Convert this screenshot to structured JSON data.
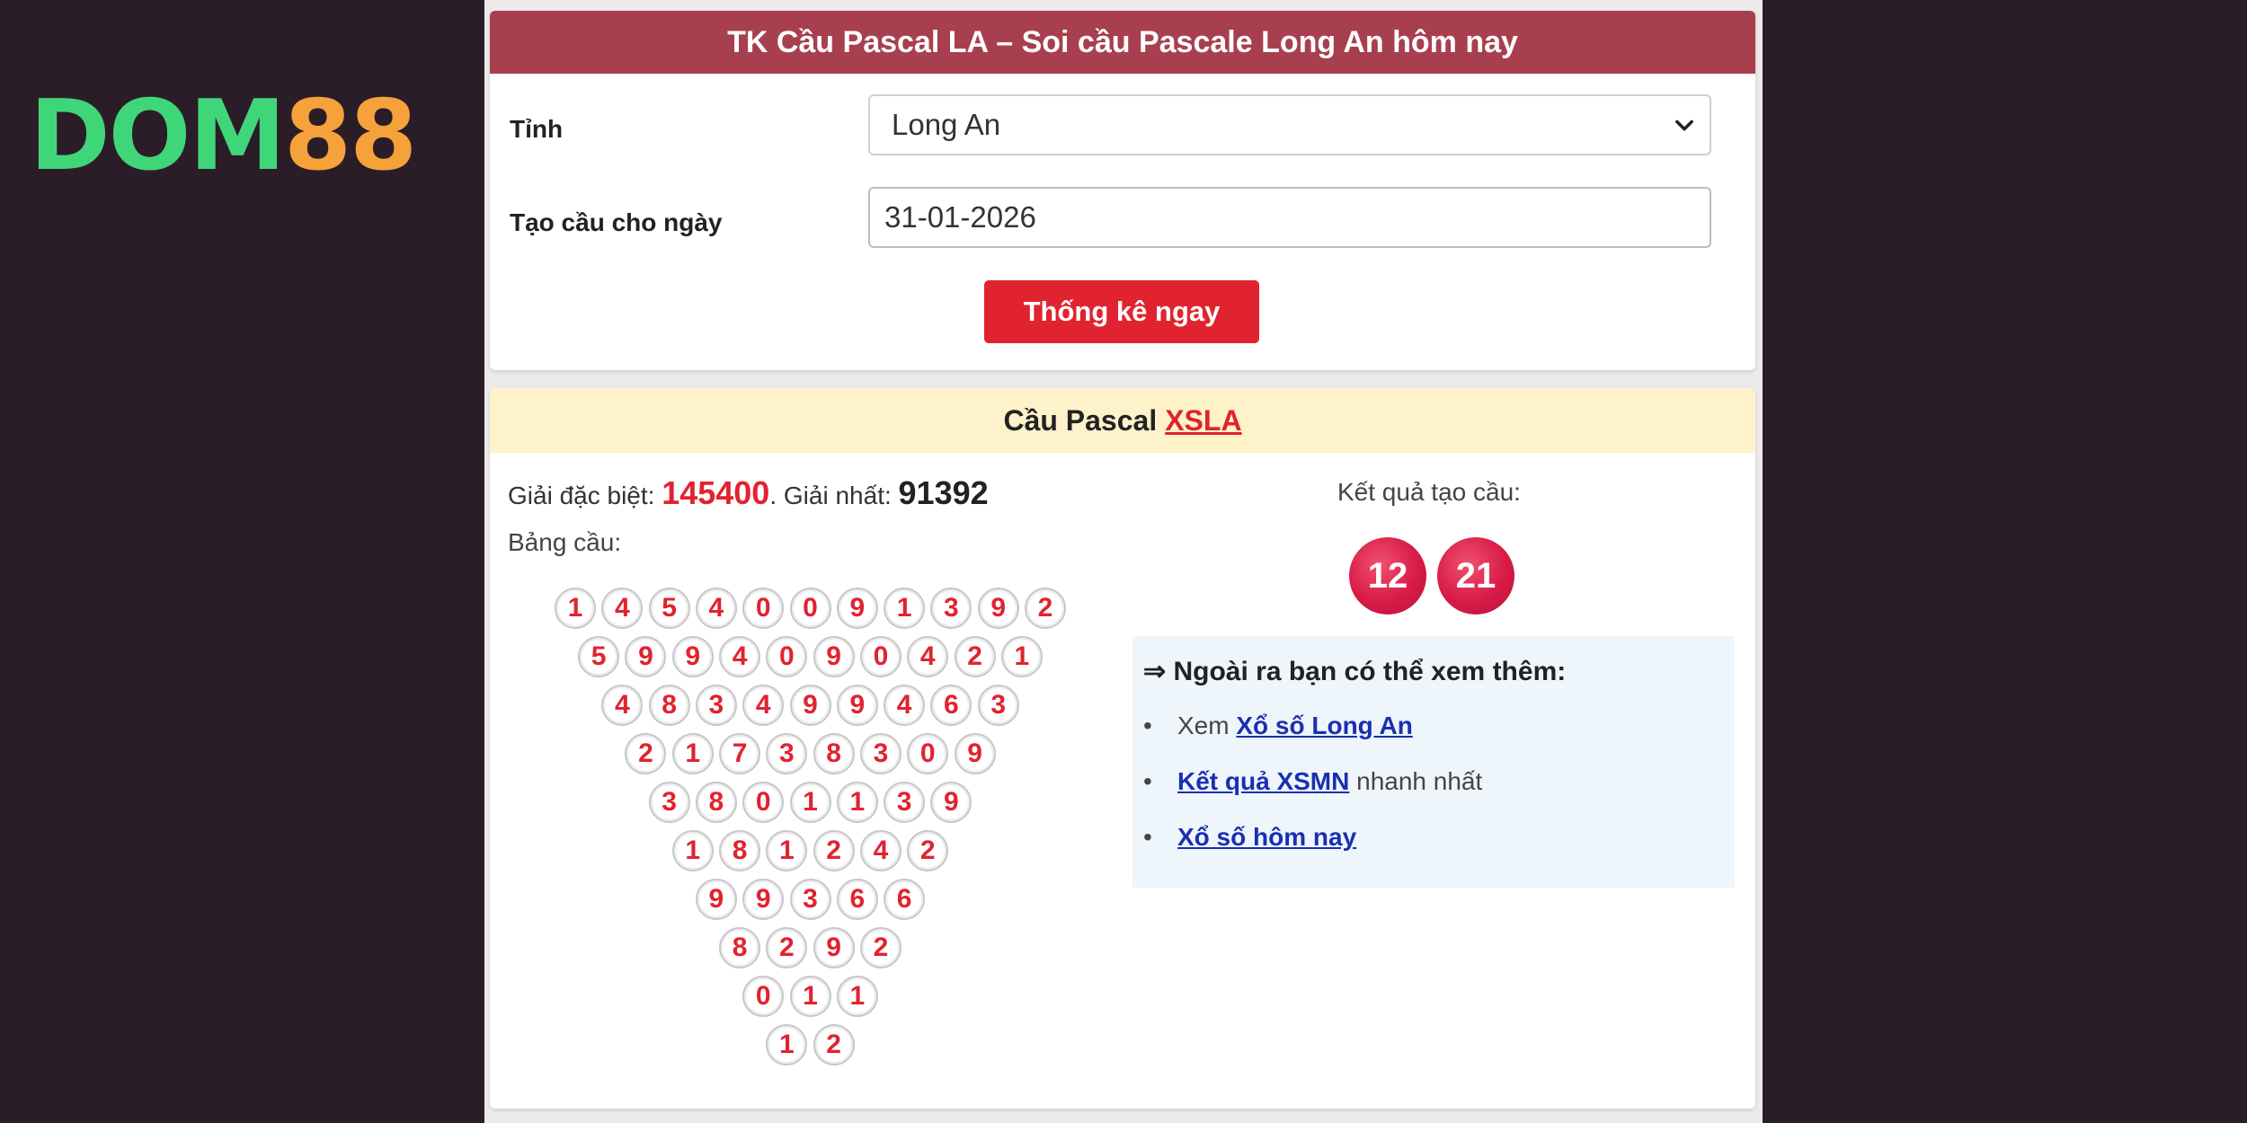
{
  "logo": {
    "part1": "DOM",
    "part2": "88"
  },
  "form": {
    "header": "TK Cầu Pascal LA – Soi cầu Pascale Long An hôm nay",
    "province_label": "Tỉnh",
    "province_value": "Long An",
    "date_label": "Tạo cầu cho ngày",
    "date_value": "31-01-2026",
    "submit_label": "Thống kê ngay"
  },
  "pascal": {
    "header_prefix": "Cầu Pascal",
    "header_link": "XSLA",
    "special_label": "Giải đặc biệt:",
    "special_value": "145400",
    "first_sep": ". Giải nhất:",
    "first_value": "91392",
    "table_label": "Bảng cầu:",
    "rows": [
      [
        "1",
        "4",
        "5",
        "4",
        "0",
        "0",
        "9",
        "1",
        "3",
        "9",
        "2"
      ],
      [
        "5",
        "9",
        "9",
        "4",
        "0",
        "9",
        "0",
        "4",
        "2",
        "1"
      ],
      [
        "4",
        "8",
        "3",
        "4",
        "9",
        "9",
        "4",
        "6",
        "3"
      ],
      [
        "2",
        "1",
        "7",
        "3",
        "8",
        "3",
        "0",
        "9"
      ],
      [
        "3",
        "8",
        "0",
        "1",
        "1",
        "3",
        "9"
      ],
      [
        "1",
        "8",
        "1",
        "2",
        "4",
        "2"
      ],
      [
        "9",
        "9",
        "3",
        "6",
        "6"
      ],
      [
        "8",
        "2",
        "9",
        "2"
      ],
      [
        "0",
        "1",
        "1"
      ],
      [
        "1",
        "2"
      ]
    ],
    "result_label": "Kết quả tạo cầu:",
    "results": [
      "12",
      "21"
    ]
  },
  "more": {
    "title": "⇒ Ngoài ra bạn có thể xem thêm:",
    "item1_prefix": "Xem ",
    "item1_link": "Xổ số Long An",
    "item2_link": "Kết quả XSMN",
    "item2_suffix": " nhanh nhất",
    "item3_link": "Xổ số hôm nay"
  }
}
